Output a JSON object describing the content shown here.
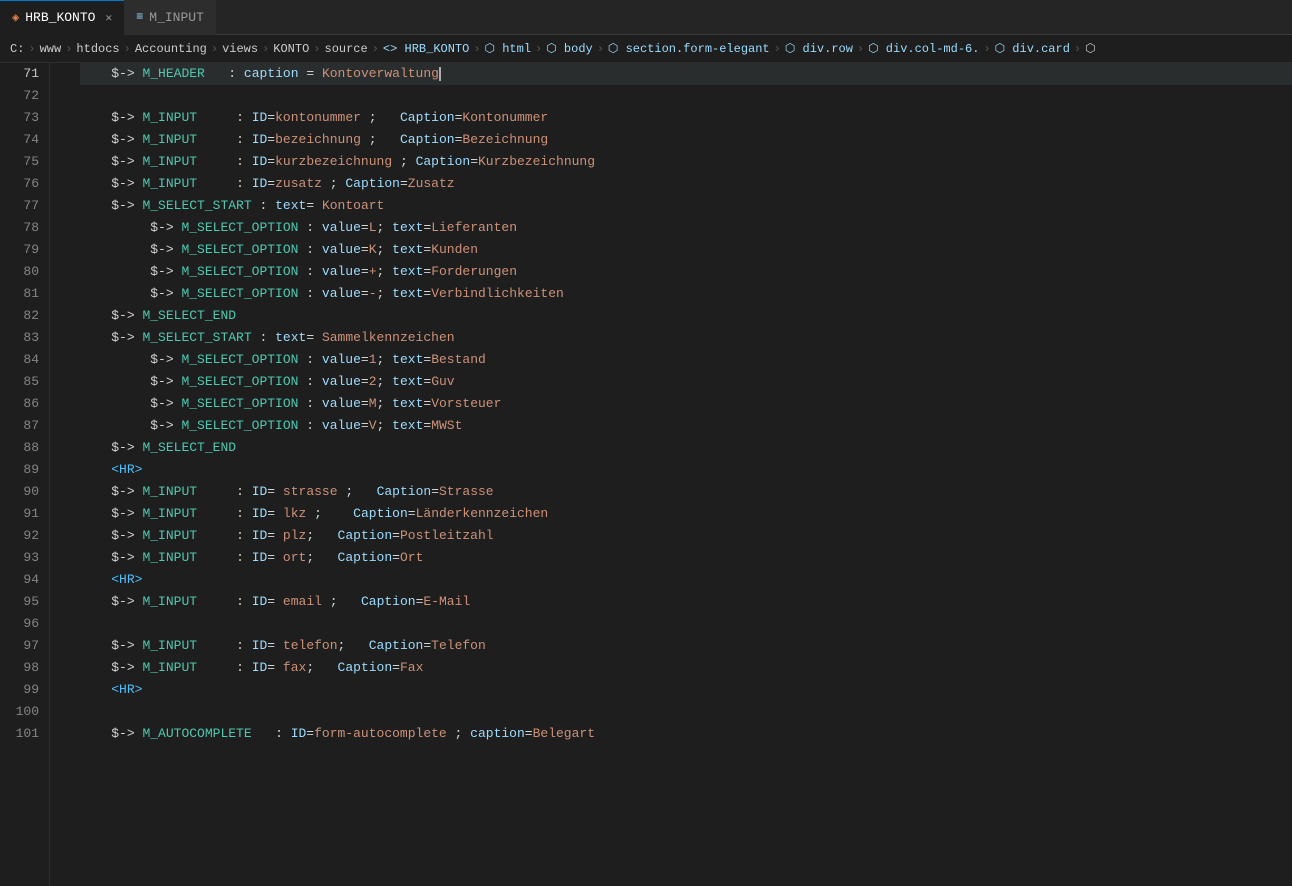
{
  "tabs": [
    {
      "id": "hrb-konto",
      "label": "HRB_KONTO",
      "icon": "hrb-icon",
      "active": true,
      "closeable": true
    },
    {
      "id": "m-input",
      "label": "M_INPUT",
      "icon": "m-icon",
      "active": false,
      "closeable": false
    }
  ],
  "breadcrumb": {
    "items": [
      "C:",
      "www",
      "htdocs",
      "Accounting",
      "views",
      "KONTO",
      "source",
      "<>",
      "HRB_KONTO",
      "html",
      "body",
      "section.form-elegant",
      "div.row",
      "div.col-md-6.",
      "div.card",
      ">"
    ]
  },
  "lines": [
    {
      "num": 71,
      "content": "    $-> M_HEADER   : caption = Kontoverwaltung",
      "active": true
    },
    {
      "num": 72,
      "content": ""
    },
    {
      "num": 73,
      "content": "    $-> M_INPUT     : ID=kontonummer ;   Caption=Kontonummer"
    },
    {
      "num": 74,
      "content": "    $-> M_INPUT     : ID=bezeichnung ;   Caption=Bezeichnung"
    },
    {
      "num": 75,
      "content": "    $-> M_INPUT     : ID=kurzbezeichnung ; Caption=Kurzbezeichnung"
    },
    {
      "num": 76,
      "content": "    $-> M_INPUT     : ID=zusatz ; Caption=Zusatz"
    },
    {
      "num": 77,
      "content": "    $-> M_SELECT_START : text= Kontoart"
    },
    {
      "num": 78,
      "content": "         $-> M_SELECT_OPTION : value=L; text=Lieferanten"
    },
    {
      "num": 79,
      "content": "         $-> M_SELECT_OPTION : value=K; text=Kunden"
    },
    {
      "num": 80,
      "content": "         $-> M_SELECT_OPTION : value=+; text=Forderungen"
    },
    {
      "num": 81,
      "content": "         $-> M_SELECT_OPTION : value=-; text=Verbindlichkeiten"
    },
    {
      "num": 82,
      "content": "    $-> M_SELECT_END"
    },
    {
      "num": 83,
      "content": "    $-> M_SELECT_START : text= Sammelkennzeichen"
    },
    {
      "num": 84,
      "content": "         $-> M_SELECT_OPTION : value=1; text=Bestand"
    },
    {
      "num": 85,
      "content": "         $-> M_SELECT_OPTION : value=2; text=Guv"
    },
    {
      "num": 86,
      "content": "         $-> M_SELECT_OPTION : value=M; text=Vorsteuer"
    },
    {
      "num": 87,
      "content": "         $-> M_SELECT_OPTION : value=V; text=MWSt"
    },
    {
      "num": 88,
      "content": "    $-> M_SELECT_END"
    },
    {
      "num": 89,
      "content": "    <HR>"
    },
    {
      "num": 90,
      "content": "    $-> M_INPUT     : ID= strasse ;   Caption=Strasse"
    },
    {
      "num": 91,
      "content": "    $-> M_INPUT     : ID= lkz ;    Caption=Länderkennzeichen"
    },
    {
      "num": 92,
      "content": "    $-> M_INPUT     : ID= plz;   Caption=Postleitzahl"
    },
    {
      "num": 93,
      "content": "    $-> M_INPUT     : ID= ort;   Caption=Ort"
    },
    {
      "num": 94,
      "content": "    <HR>"
    },
    {
      "num": 95,
      "content": "    $-> M_INPUT     : ID= email ;   Caption=E-Mail"
    },
    {
      "num": 96,
      "content": ""
    },
    {
      "num": 97,
      "content": "    $-> M_INPUT     : ID= telefon;   Caption=Telefon"
    },
    {
      "num": 98,
      "content": "    $-> M_INPUT     : ID= fax;   Caption=Fax"
    },
    {
      "num": 99,
      "content": "    <HR>"
    },
    {
      "num": 100,
      "content": ""
    },
    {
      "num": 101,
      "content": "    $-> M_AUTOCOMPLETE   : ID=form-autocomplete ; caption=Belegart"
    }
  ]
}
